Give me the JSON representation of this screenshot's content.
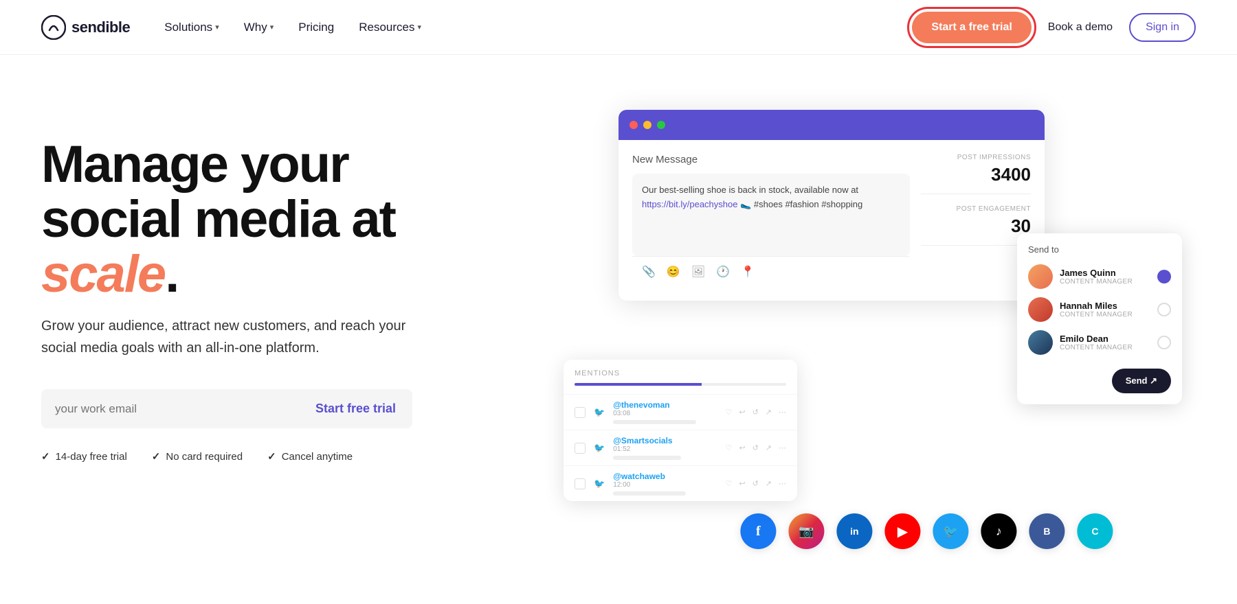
{
  "nav": {
    "logo_text": "sendible",
    "links": [
      {
        "label": "Solutions",
        "has_dropdown": true
      },
      {
        "label": "Why",
        "has_dropdown": true
      },
      {
        "label": "Pricing",
        "has_dropdown": false
      },
      {
        "label": "Resources",
        "has_dropdown": true
      }
    ],
    "cta_trial": "Start a free trial",
    "cta_demo": "Book a demo",
    "cta_signin": "Sign in"
  },
  "hero": {
    "heading_line1": "Manage your",
    "heading_line2": "social media at",
    "heading_scale": "scale",
    "heading_period": ".",
    "subtext": "Grow your audience, attract new customers, and reach your social media goals with an all-in-one platform.",
    "email_placeholder": "your work email",
    "start_free_trial": "Start free trial",
    "trust": [
      {
        "text": "14-day free trial"
      },
      {
        "text": "No card required"
      },
      {
        "text": "Cancel anytime"
      }
    ]
  },
  "mockup": {
    "new_message": "New Message",
    "compose_text": "Our best-selling shoe is back in stock, available now at",
    "compose_link": "https://bit.ly/peachyshoe",
    "compose_hashtags": "🥿 #shoes #fashion #shopping",
    "post_impressions_label": "POST IMPRESSIONS",
    "post_impressions_value": "3400",
    "post_engagement_label": "POST ENGAGEMENT",
    "post_engagement_value": "30",
    "send_to_label": "Send to",
    "persons": [
      {
        "name": "James Quinn",
        "role": "CONTENT MANAGER",
        "selected": true
      },
      {
        "name": "Hannah Miles",
        "role": "CONTENT MANAGER",
        "selected": false
      },
      {
        "name": "Emilo Dean",
        "role": "CONTENT MANAGER",
        "selected": false
      }
    ],
    "send_button": "Send ↗",
    "mentions_label": "MENTIONS",
    "mentions": [
      {
        "handle": "@thenevoman",
        "time": "03:08"
      },
      {
        "handle": "@Smartsocials",
        "time": "01:52"
      },
      {
        "handle": "@watchaweb",
        "time": "12:00"
      }
    ],
    "social_icons": [
      {
        "name": "facebook-icon",
        "class": "si-fb",
        "symbol": "f"
      },
      {
        "name": "instagram-icon",
        "class": "si-ig",
        "symbol": "📷"
      },
      {
        "name": "linkedin-icon",
        "class": "si-li",
        "symbol": "in"
      },
      {
        "name": "youtube-icon",
        "class": "si-yt",
        "symbol": "▶"
      },
      {
        "name": "twitter-icon",
        "class": "si-tw",
        "symbol": "🐦"
      },
      {
        "name": "tiktok-icon",
        "class": "si-tk",
        "symbol": "♪"
      },
      {
        "name": "buffer-icon",
        "class": "si-bf",
        "symbol": "B"
      },
      {
        "name": "cx-icon",
        "class": "si-cx",
        "symbol": "C"
      }
    ]
  },
  "colors": {
    "accent_orange": "#f47c5a",
    "accent_purple": "#5a4fcf",
    "highlight_red": "#e8333a"
  }
}
